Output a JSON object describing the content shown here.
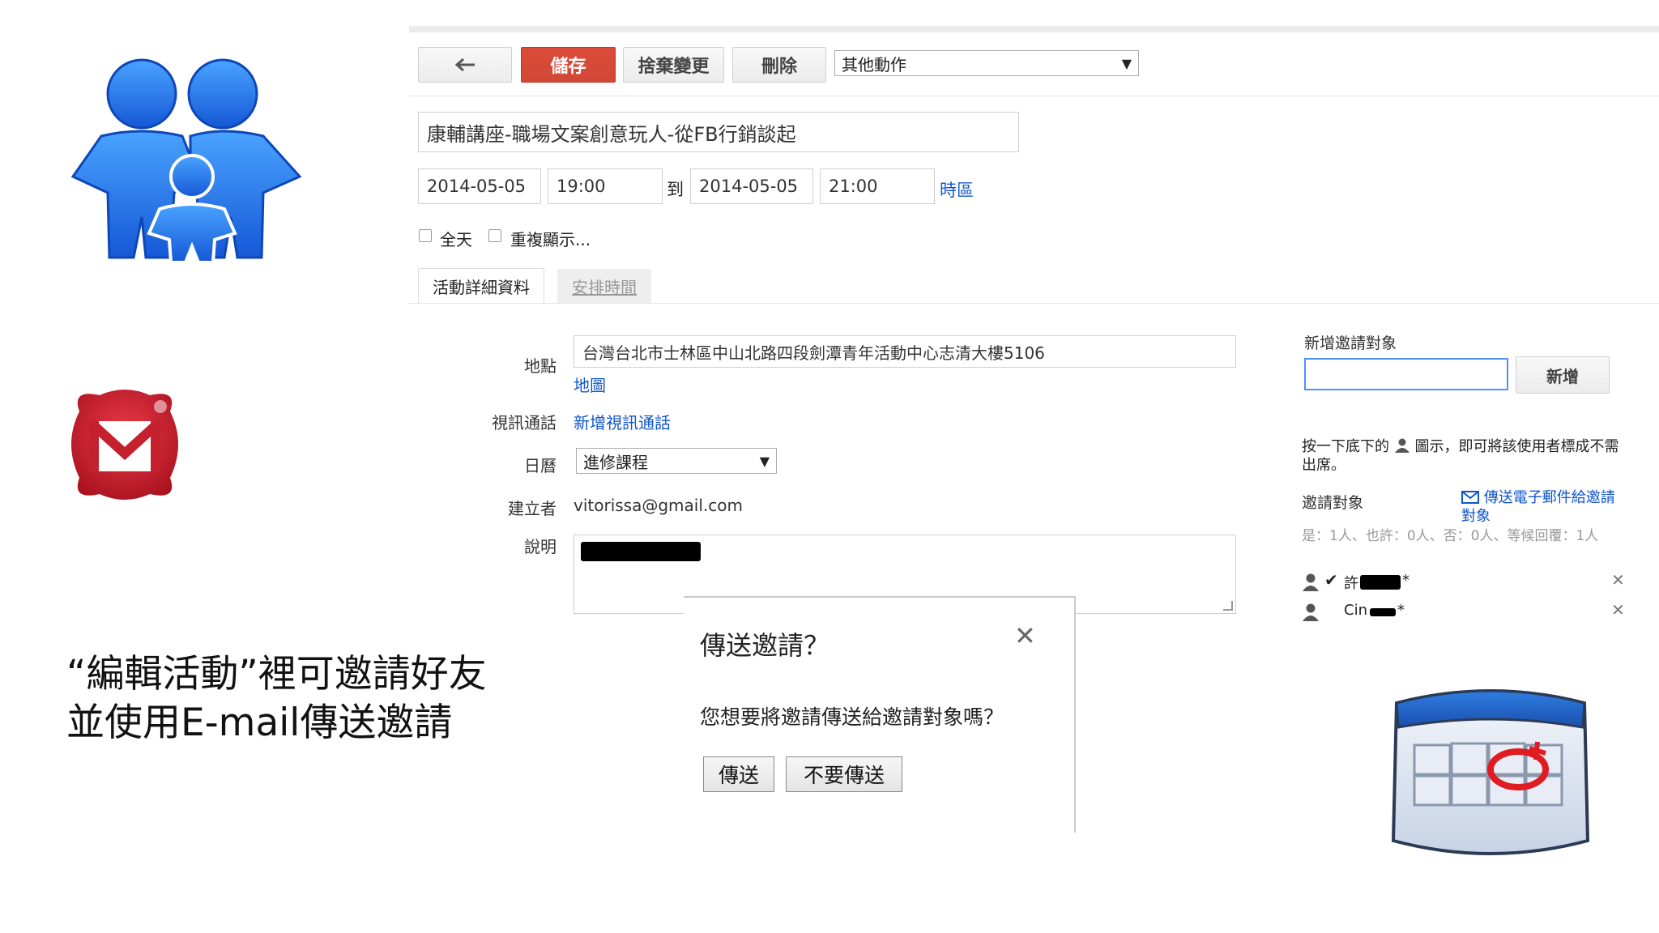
{
  "toolbar": {
    "back_icon": "arrow-back-icon",
    "save": "儲存",
    "discard": "捨棄變更",
    "delete": "刪除",
    "more_actions": "其他動作"
  },
  "event": {
    "title": "康輔講座-職場文案創意玩人-從FB行銷談起",
    "start_date": "2014-05-05",
    "start_time": "19:00",
    "to": "到",
    "end_date": "2014-05-05",
    "end_time": "21:00",
    "timezone": "時區",
    "all_day": "全天",
    "repeat": "重複顯示..."
  },
  "tabs": {
    "details": "活動詳細資料",
    "schedule": "安排時間"
  },
  "details": {
    "location_label": "地點",
    "location_value": "台灣台北市士林區中山北路四段劍潭青年活動中心志清大樓5106",
    "map_link": "地圖",
    "video_label": "視訊通話",
    "video_link": "新增視訊通話",
    "calendar_label": "日曆",
    "calendar_value": "進修課程",
    "creator_label": "建立者",
    "creator_value": "vitorissa@gmail.com",
    "description_label": "說明"
  },
  "guests": {
    "add_label": "新增邀請對象",
    "add_button": "新增",
    "hint": "按一下底下的",
    "hint_rest": "圖示，即可將該使用者標成不需出席。",
    "guests_label": "邀請對象",
    "email_link": "傳送電子郵件給邀請對象",
    "summary": "是：1人、也許：0人、否：0人、等候回覆：1人",
    "list": [
      {
        "name": "許",
        "suffix": "*"
      },
      {
        "name": "Cin",
        "suffix": "*"
      }
    ]
  },
  "dialog": {
    "title": "傳送邀請？",
    "message": "您想要將邀請傳送給邀請對象嗎？",
    "send": "傳送",
    "dont_send": "不要傳送",
    "close_icon": "close-icon"
  },
  "caption": {
    "line1": "“編輯活動”裡可邀請好友",
    "line2": "並使用E-mail傳送邀請"
  },
  "colors": {
    "primary_button": "#d14836",
    "link": "#1155cc",
    "family_icon": "#1a6fe0",
    "mail_icon": "#c4202e"
  }
}
